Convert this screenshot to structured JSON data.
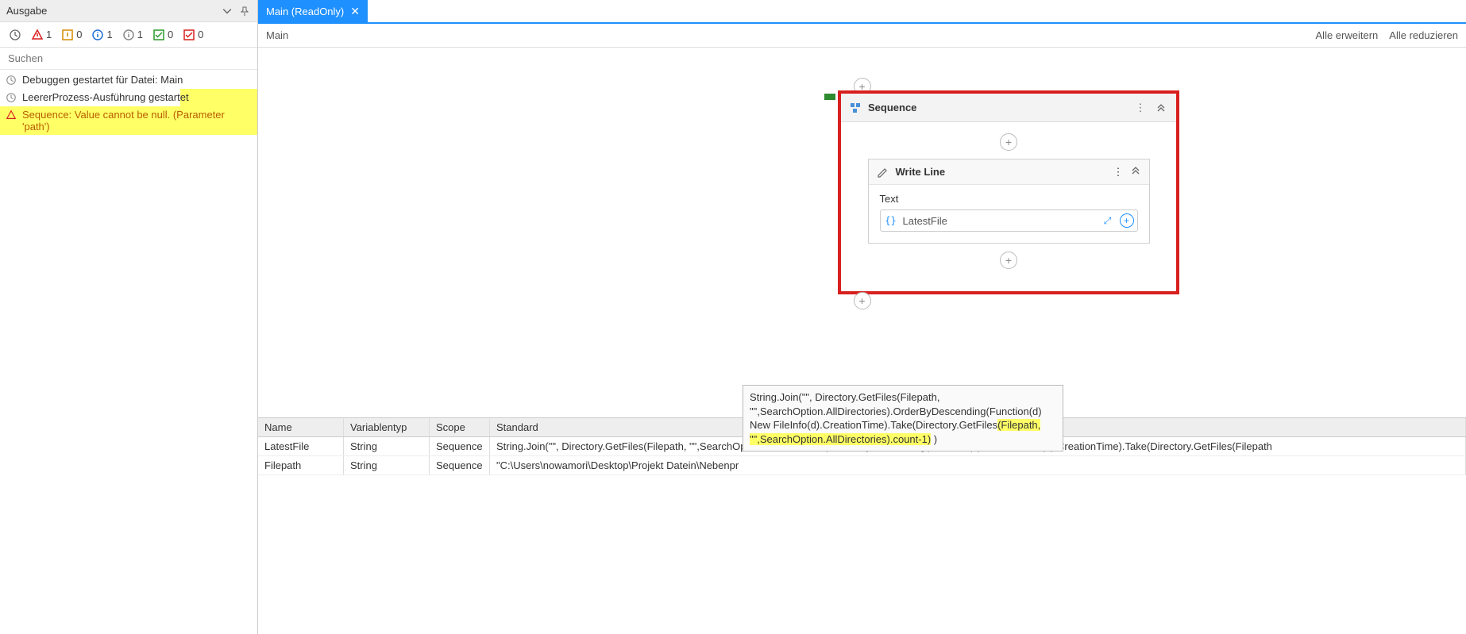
{
  "leftPanel": {
    "title": "Ausgabe",
    "filters": {
      "clock": "",
      "error": "1",
      "warning": "0",
      "infoBlue": "1",
      "infoGray": "1",
      "okGreen": "0",
      "okRed": "0"
    },
    "searchPlaceholder": "Suchen",
    "logs": [
      {
        "icon": "clock",
        "text": "Debuggen gestartet für Datei: Main"
      },
      {
        "icon": "clock",
        "text": "LeererProzess-Ausführung gestartet"
      },
      {
        "icon": "error",
        "text": "Sequence: Value cannot be null. (Parameter 'path')",
        "highlight": true
      }
    ]
  },
  "tab": {
    "label": "Main (ReadOnly)"
  },
  "breadcrumb": "Main",
  "expandAll": "Alle erweitern",
  "collapseAll": "Alle reduzieren",
  "sequence": {
    "title": "Sequence",
    "writeLine": {
      "title": "Write Line",
      "fieldLabel": "Text",
      "value": "LatestFile"
    }
  },
  "varsTable": {
    "headers": {
      "name": "Name",
      "type": "Variablentyp",
      "scope": "Scope",
      "default": "Standard"
    },
    "rows": [
      {
        "name": "LatestFile",
        "type": "String",
        "scope": "Sequence",
        "default": "String.Join(\"\", Directory.GetFiles(Filepath, \"\",SearchOption.AllDirectories).OrderByDescending(Function(d) New FileInfo(d).CreationTime).Take(Directory.GetFiles(Filepath"
      },
      {
        "name": "Filepath",
        "type": "String",
        "scope": "Sequence",
        "default": "\"C:\\Users\\nowamori\\Desktop\\Projekt Datein\\Nebenpr"
      }
    ]
  },
  "tooltip": {
    "pre": "String.Join(\"\", Directory.GetFiles(Filepath, \"\",SearchOption.AllDirectories).OrderByDescending(Function(d) New FileInfo(d).CreationTime).Take(Directory.GetFiles",
    "hl1": "(Filepath, ",
    "mid": "",
    "hl2": "\"\",SearchOption.AllDirectories).count-1)",
    "post": " )"
  }
}
